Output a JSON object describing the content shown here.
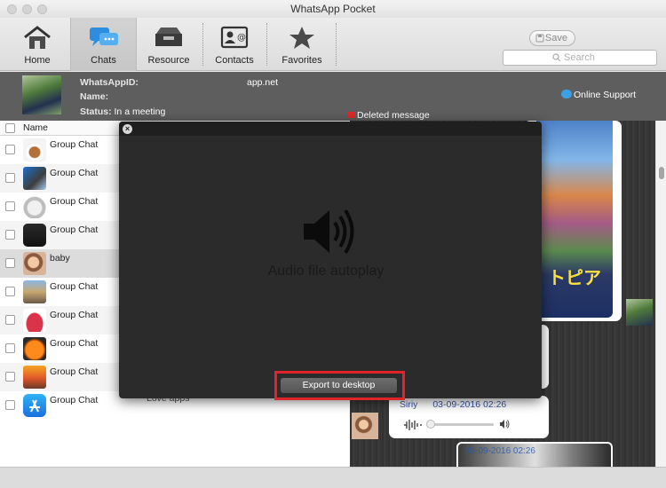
{
  "window": {
    "title": "WhatsApp Pocket"
  },
  "toolbar": {
    "items": [
      {
        "label": "Home",
        "icon": "home-icon"
      },
      {
        "label": "Chats",
        "icon": "chats-icon"
      },
      {
        "label": "Resource",
        "icon": "resource-icon"
      },
      {
        "label": "Contacts",
        "icon": "contacts-icon"
      },
      {
        "label": "Favorites",
        "icon": "favorites-icon"
      }
    ],
    "active_tab": "Chats",
    "save_label": "Save",
    "search_placeholder": "Search"
  },
  "info": {
    "whatsapp_id_label": "WhatsAppID:",
    "whatsapp_id_value": "app.net",
    "name_label": "Name:",
    "status_label": "Status:",
    "status_value": "In a meeting",
    "support_label": "Online Support",
    "deleted_label": "Deleted message"
  },
  "list": {
    "header": "Name",
    "rows": [
      {
        "name": "Group Chat",
        "thumb": "coffee-cup"
      },
      {
        "name": "Group Chat",
        "thumb": "app-icon"
      },
      {
        "name": "Group Chat",
        "thumb": "cat"
      },
      {
        "name": "Group Chat",
        "thumb": "device"
      },
      {
        "name": "baby",
        "thumb": "baby",
        "selected": true
      },
      {
        "name": "Group Chat",
        "thumb": "city"
      },
      {
        "name": "Group Chat",
        "thumb": "handbag"
      },
      {
        "name": "Group Chat",
        "thumb": "pumpkin"
      },
      {
        "name": "Group Chat",
        "thumb": "sunset"
      },
      {
        "name": "Group Chat",
        "thumb": "app-store",
        "extra": "Love apps"
      }
    ]
  },
  "overlay": {
    "label": "Audio file autoplay",
    "export_label": "Export to desktop"
  },
  "chat": {
    "audio_sender": "Siriy",
    "audio_time": "03-09-2016 02:26",
    "photo_time": "03-09-2016 02:26",
    "poster_text": "トピア"
  },
  "colors": {
    "accent_blue": "#3aa0e8",
    "highlight_red": "#e0242a",
    "infobar": "#5e5e5e"
  }
}
